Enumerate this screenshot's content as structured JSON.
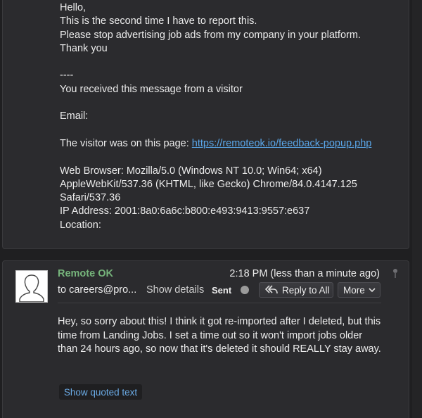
{
  "first_message": {
    "lines": [
      "Hello,",
      "This is the second time I have to report this.",
      "Please stop advertising job ads from my company in your platform.",
      "Thank you",
      "",
      "----",
      "You received this message from a visitor",
      "",
      "Email:",
      "",
      "The visitor was on this page: ",
      "",
      "Web Browser: Mozilla/5.0 (Windows NT 10.0; Win64; x64)",
      "AppleWebKit/537.36 (KHTML, like Gecko) Chrome/84.0.4147.125",
      "Safari/537.36",
      "IP Address: 2001:8a0:6a6c:b800:e493:9413:9557:e637",
      "Location:"
    ],
    "page_link": "https://remoteok.io/feedback-popup.php"
  },
  "second_message": {
    "sender": "Remote OK",
    "timestamp": "2:18 PM (less than a minute ago)",
    "to": "to careers@pro...",
    "show_details": "Show details",
    "sent_label": "Sent",
    "reply_all_label": "Reply to All",
    "more_label": "More",
    "body": "Hey, so sorry about this! I think it got re-imported after I deleted, but this time from Landing Jobs. I set a time out so it won't import jobs older than 24 hours ago, so now that it's deleted it should REALLY stay away.",
    "show_quoted_label": "Show quoted text"
  },
  "colors": {
    "background": "#1f1f21",
    "card": "#2b2b2e",
    "sender_green": "#76b47b",
    "link_blue": "#5aa7ea"
  },
  "icons": {
    "avatar": "person-silhouette-icon",
    "reply_all": "reply-all-icon",
    "more": "chevron-down-icon",
    "pin": "pin-icon",
    "sent_status": "status-dot-icon"
  }
}
